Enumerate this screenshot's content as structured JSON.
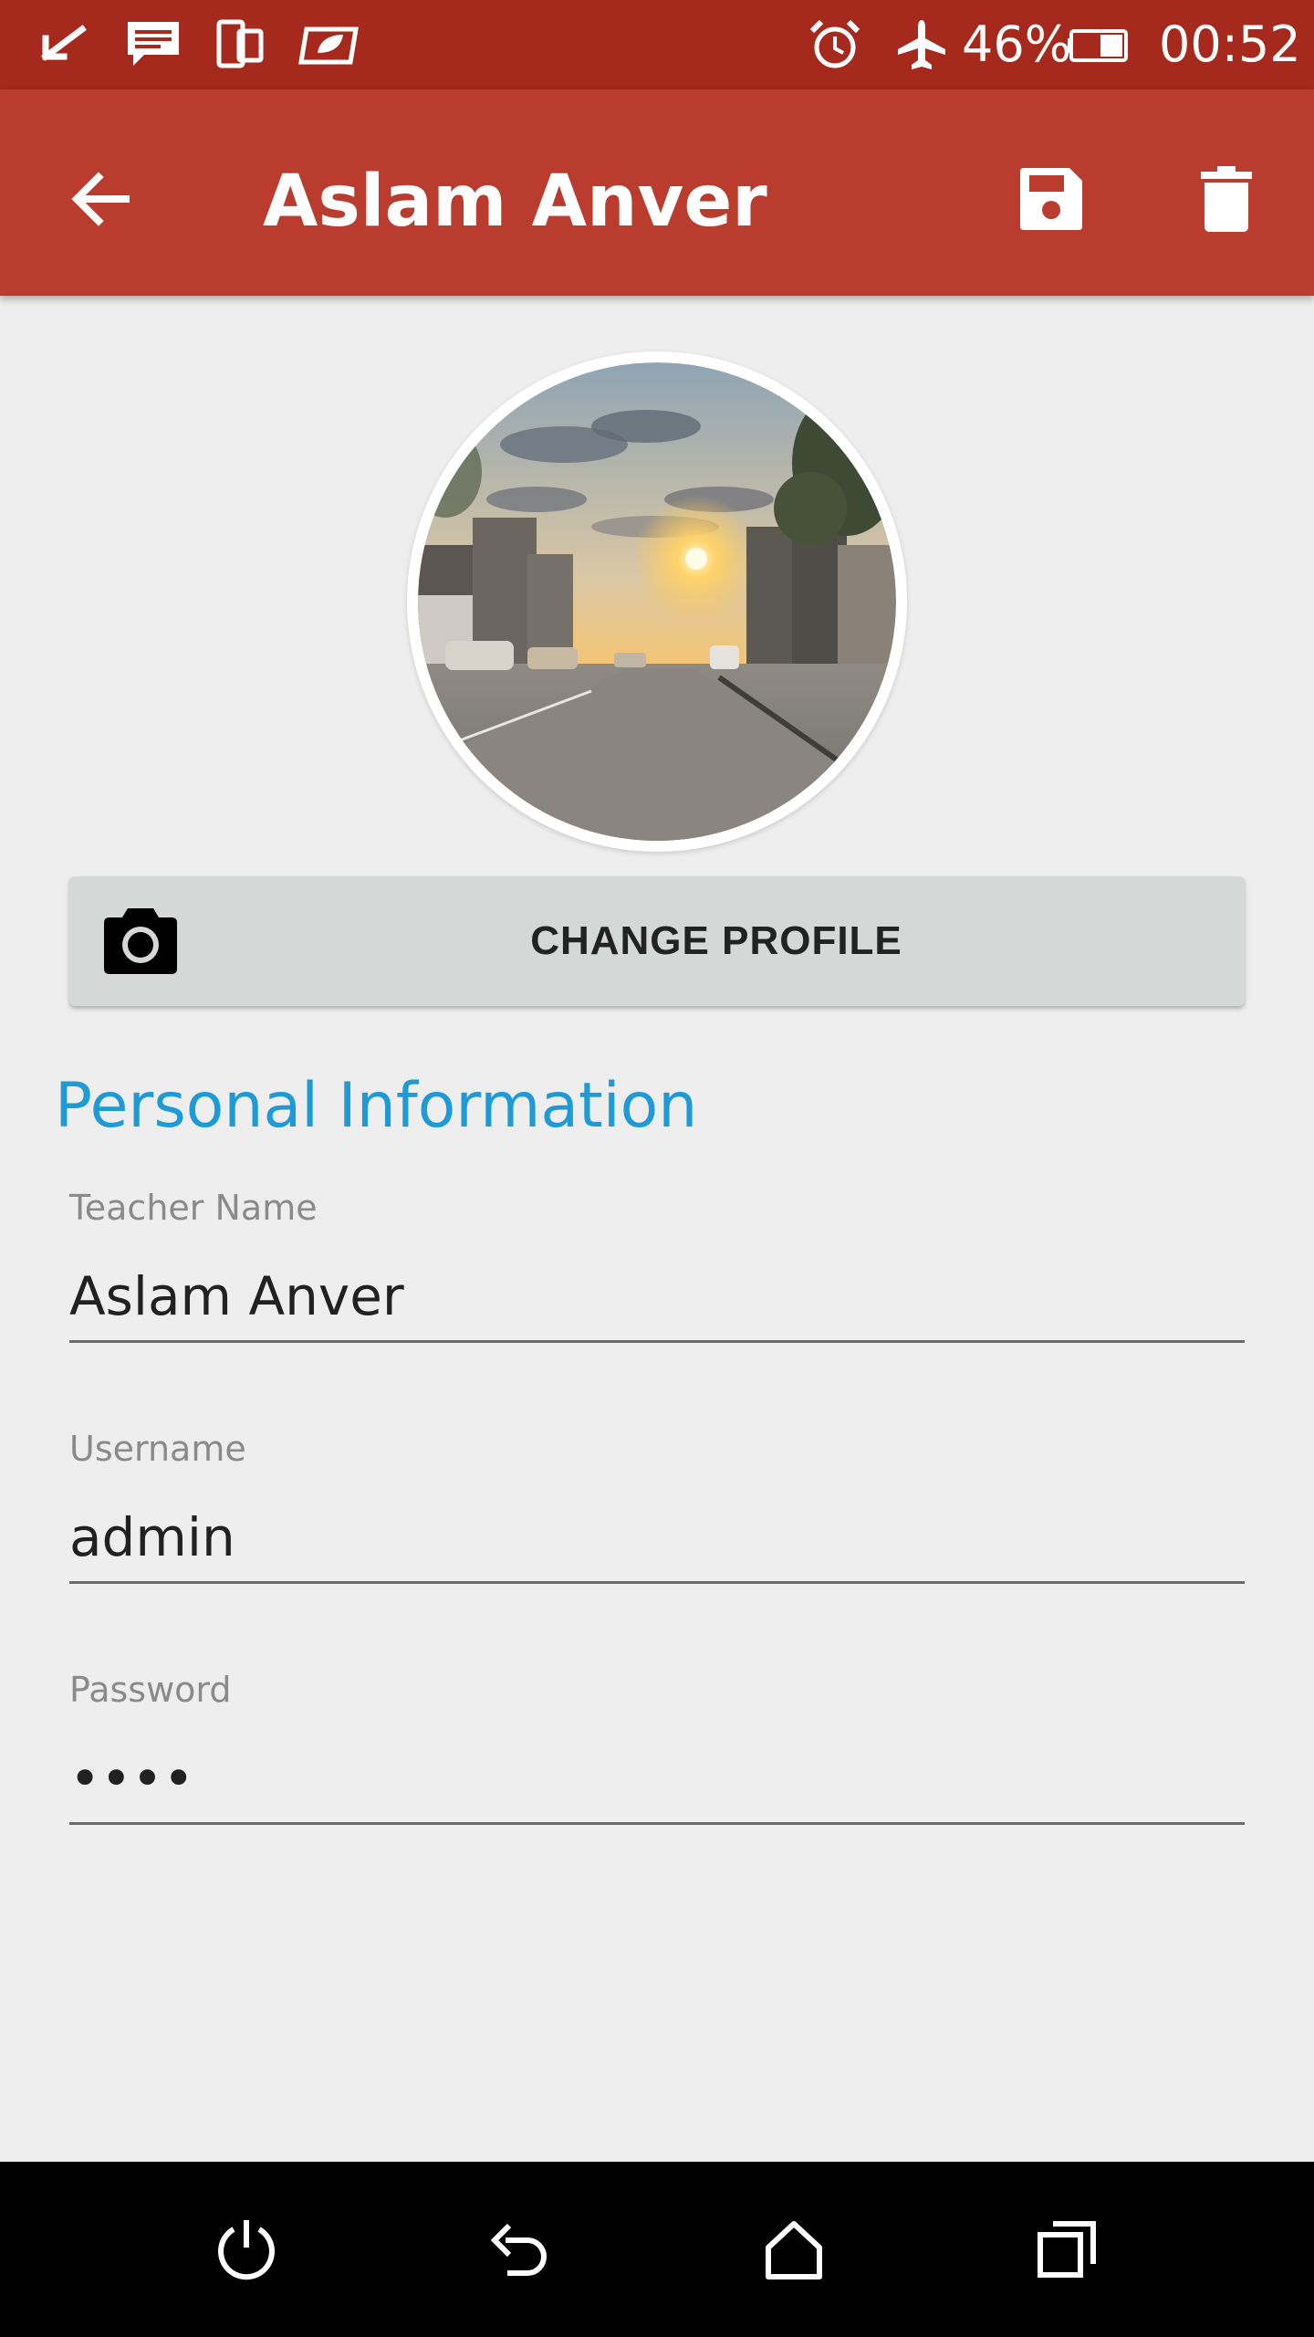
{
  "status_bar": {
    "battery_percent": "46%",
    "time": "00:52",
    "icons": [
      "checkmark-icon",
      "message-icon",
      "phone-tablet-icon",
      "leaf-card-icon",
      "alarm-icon",
      "airplane-icon",
      "battery-icon"
    ]
  },
  "app_bar": {
    "title": "Aslam Anver",
    "back_icon": "arrow-back-icon",
    "save_icon": "save-icon",
    "delete_icon": "delete-icon",
    "color": "#b93c2f"
  },
  "profile": {
    "change_button_label": "CHANGE PROFILE",
    "camera_icon": "camera-icon"
  },
  "section": {
    "title": "Personal Information",
    "color": "#1e9ad6"
  },
  "fields": {
    "teacher_name": {
      "label": "Teacher Name",
      "value": "Aslam Anver"
    },
    "username": {
      "label": "Username",
      "value": "admin"
    },
    "password": {
      "label": "Password",
      "value": "••••"
    }
  },
  "nav_bar": {
    "icons": [
      "power-icon",
      "back-icon",
      "home-icon",
      "recents-icon"
    ]
  }
}
